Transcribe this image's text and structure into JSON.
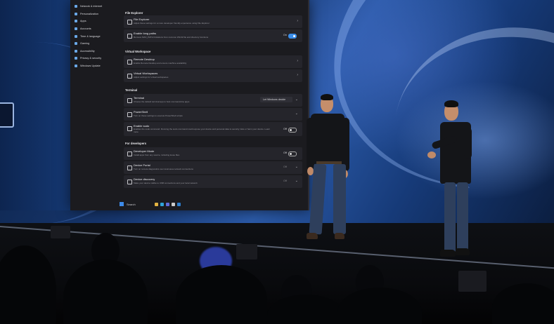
{
  "sidebar": {
    "items": [
      {
        "label": "Network & internet"
      },
      {
        "label": "Personalization"
      },
      {
        "label": "Apps"
      },
      {
        "label": "Accounts"
      },
      {
        "label": "Time & language"
      },
      {
        "label": "Gaming"
      },
      {
        "label": "Accessibility"
      },
      {
        "label": "Privacy & security"
      },
      {
        "label": "Windows Update"
      }
    ]
  },
  "sections": {
    "file_explorer": {
      "title": "File Explorer",
      "rows": [
        {
          "title": "File Explorer",
          "subtitle": "Adjust these settings for a more developer friendly experience using File Explorer"
        },
        {
          "title": "Enable long paths",
          "subtitle": "Remove MAX_PATH limitations from common Win32 file and directory functions",
          "state": "On"
        }
      ]
    },
    "virtual_workspace": {
      "title": "Virtual Workspace",
      "rows": [
        {
          "title": "Remote Desktop",
          "subtitle": "Enable Remote Desktop and ensure machine availability"
        },
        {
          "title": "Virtual Workspaces",
          "subtitle": "Adjust settings for virtual workspaces"
        }
      ]
    },
    "terminal": {
      "title": "Terminal",
      "rows": [
        {
          "title": "Terminal",
          "subtitle": "Choose the default terminal app to host command-line apps",
          "value": "Let Windows decide"
        },
        {
          "title": "PowerShell",
          "subtitle": "Turn on these settings to execute PowerShell scripts"
        },
        {
          "title": "Enable sudo",
          "subtitle": "Enables the sudo command. Running the sudo command could expose your device and personal data to security risks or harm your device. Learn more",
          "state": "Off"
        }
      ]
    },
    "for_developers": {
      "title": "For developers",
      "rows": [
        {
          "title": "Developer Mode",
          "subtitle": "Install apps from any source, including loose files",
          "state": "Off"
        },
        {
          "title": "Device Portal",
          "subtitle": "Turn on remote diagnostics over local area network connections",
          "state": "Off"
        },
        {
          "title": "Device discovery",
          "subtitle": "Make your device visible to USB connections and your local network",
          "state": "Off"
        }
      ]
    }
  },
  "taskbar": {
    "search": "Search"
  },
  "colors": {
    "accent": "#3b8eea",
    "window_bg": "#1b1b1f",
    "backdrop": "#1f4a92"
  },
  "icons": {
    "start": "windows-logo-icon",
    "apps": [
      "file-explorer-icon",
      "edge-icon",
      "store-icon",
      "terminal-icon",
      "vscode-icon"
    ]
  }
}
